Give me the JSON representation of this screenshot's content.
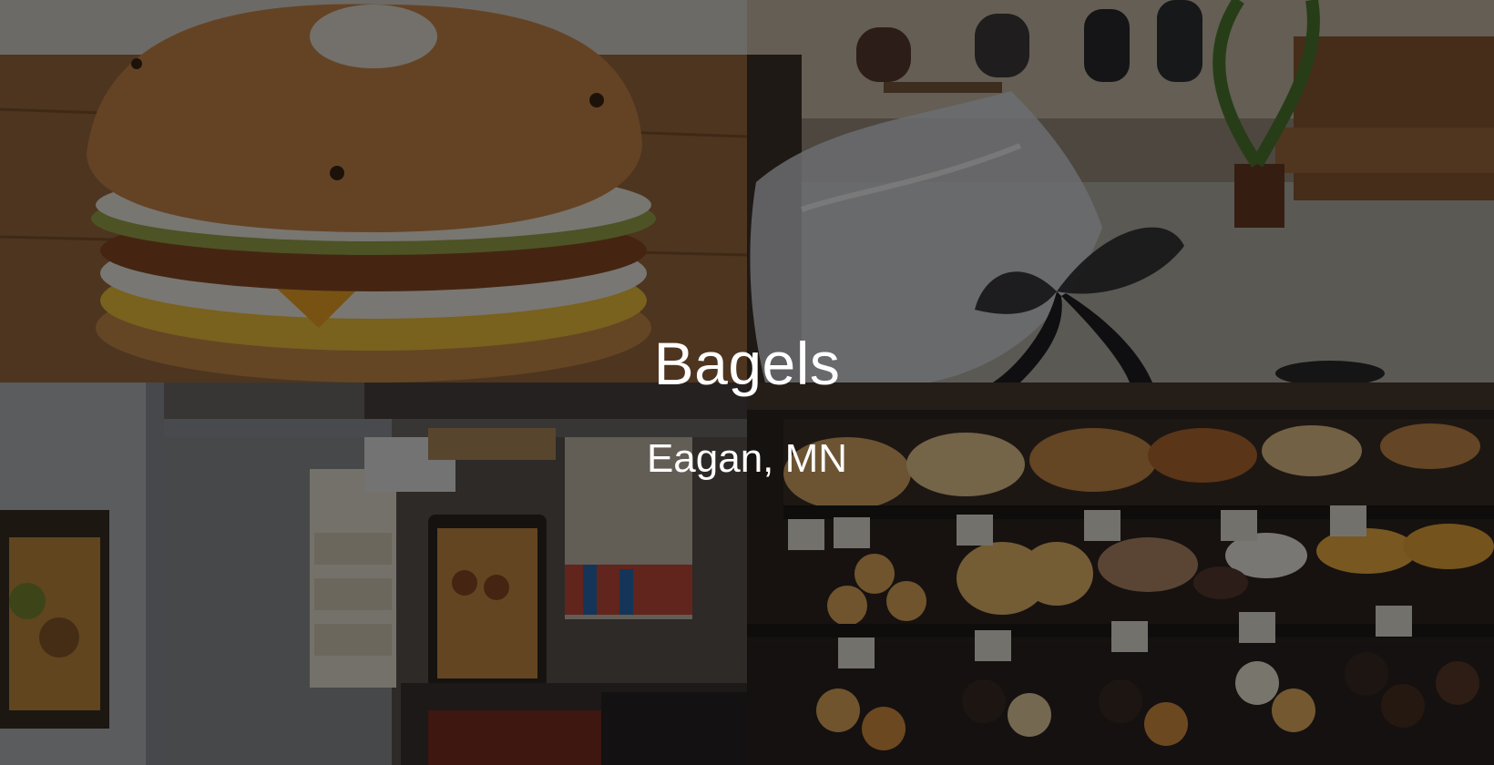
{
  "hero": {
    "title": "Bagels",
    "location": "Eagan, MN"
  },
  "collage": {
    "tiles": [
      {
        "name": "bagel-sandwich-photo"
      },
      {
        "name": "cafe-interior-gift-bag-photo"
      },
      {
        "name": "bakery-counter-photo"
      },
      {
        "name": "donut-display-case-photo"
      }
    ]
  },
  "colors": {
    "overlay": "#000000",
    "text": "#ffffff"
  }
}
